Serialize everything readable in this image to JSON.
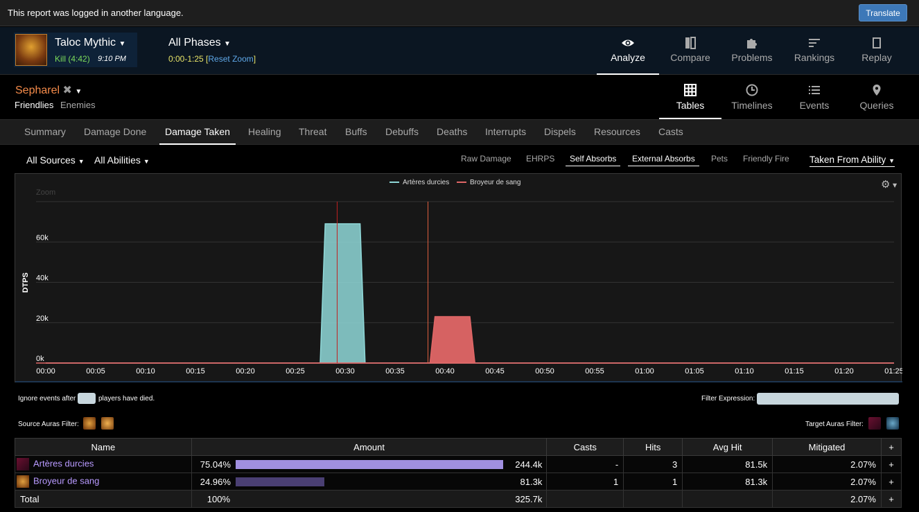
{
  "notice": {
    "message": "This report was logged in another language.",
    "translate_label": "Translate"
  },
  "header": {
    "boss_name": "Taloc Mythic",
    "kill": "Kill (4:42)",
    "time": "9:10 PM",
    "phase": "All Phases",
    "range": "0:00-1:25",
    "reset_zoom": "Reset Zoom",
    "nav": [
      "Analyze",
      "Compare",
      "Problems",
      "Rankings",
      "Replay"
    ]
  },
  "subheader": {
    "actor": "Sepharel",
    "friendlies": "Friendlies",
    "enemies": "Enemies",
    "views": [
      "Tables",
      "Timelines",
      "Events",
      "Queries"
    ]
  },
  "tabs": [
    "Summary",
    "Damage Done",
    "Damage Taken",
    "Healing",
    "Threat",
    "Buffs",
    "Debuffs",
    "Deaths",
    "Interrupts",
    "Dispels",
    "Resources",
    "Casts"
  ],
  "filters": {
    "sources": "All Sources",
    "abilities": "All Abilities",
    "options": [
      "Raw Damage",
      "EHRPS",
      "Self Absorbs",
      "External Absorbs",
      "Pets",
      "Friendly Fire"
    ],
    "taken_from": "Taken From Ability",
    "ignore_prefix": "Ignore events after",
    "ignore_suffix": "players have died.",
    "filter_expression": "Filter Expression:",
    "source_auras": "Source Auras Filter:",
    "target_auras": "Target Auras Filter:"
  },
  "chart_data": {
    "type": "area",
    "zoom_label": "Zoom",
    "ylabel": "DTPS",
    "ylim": [
      0,
      80000
    ],
    "y_ticks": [
      "0k",
      "20k",
      "40k",
      "60k"
    ],
    "x_ticks": [
      "00:00",
      "00:05",
      "00:10",
      "00:15",
      "00:20",
      "00:25",
      "00:30",
      "00:35",
      "00:40",
      "00:45",
      "00:50",
      "00:55",
      "01:00",
      "01:05",
      "01:10",
      "01:15",
      "01:20",
      "01:25"
    ],
    "xlim_seconds": [
      0,
      85
    ],
    "series": [
      {
        "name": "Artères durcies",
        "color": "#8fd8d8",
        "points": [
          [
            0,
            0
          ],
          [
            27.5,
            0
          ],
          [
            28,
            69000
          ],
          [
            31.5,
            69000
          ],
          [
            32,
            0
          ],
          [
            85,
            0
          ]
        ]
      },
      {
        "name": "Broyeur de sang",
        "color": "#e06666",
        "points": [
          [
            0,
            0
          ],
          [
            38.5,
            0
          ],
          [
            39,
            23000
          ],
          [
            42.5,
            23000
          ],
          [
            43,
            0
          ],
          [
            85,
            0
          ]
        ]
      }
    ],
    "markers_seconds": [
      29.2,
      38.3
    ]
  },
  "table": {
    "columns": [
      "Name",
      "Amount",
      "Casts",
      "Hits",
      "Avg Hit",
      "Mitigated",
      "+"
    ],
    "rows": [
      {
        "name": "Artères durcies",
        "pct": "75.04%",
        "fraction": 0.7504,
        "amount": "244.4k",
        "casts": "-",
        "hits": "3",
        "avg": "81.5k",
        "mitigated": "2.07%",
        "bar_color": "#a08fe0"
      },
      {
        "name": "Broyeur de sang",
        "pct": "24.96%",
        "fraction": 0.2496,
        "amount": "81.3k",
        "casts": "1",
        "hits": "1",
        "avg": "81.3k",
        "mitigated": "2.07%",
        "bar_color": "#4a3f73"
      }
    ],
    "total": {
      "label": "Total",
      "pct": "100%",
      "amount": "325.7k",
      "mitigated": "2.07%"
    }
  }
}
